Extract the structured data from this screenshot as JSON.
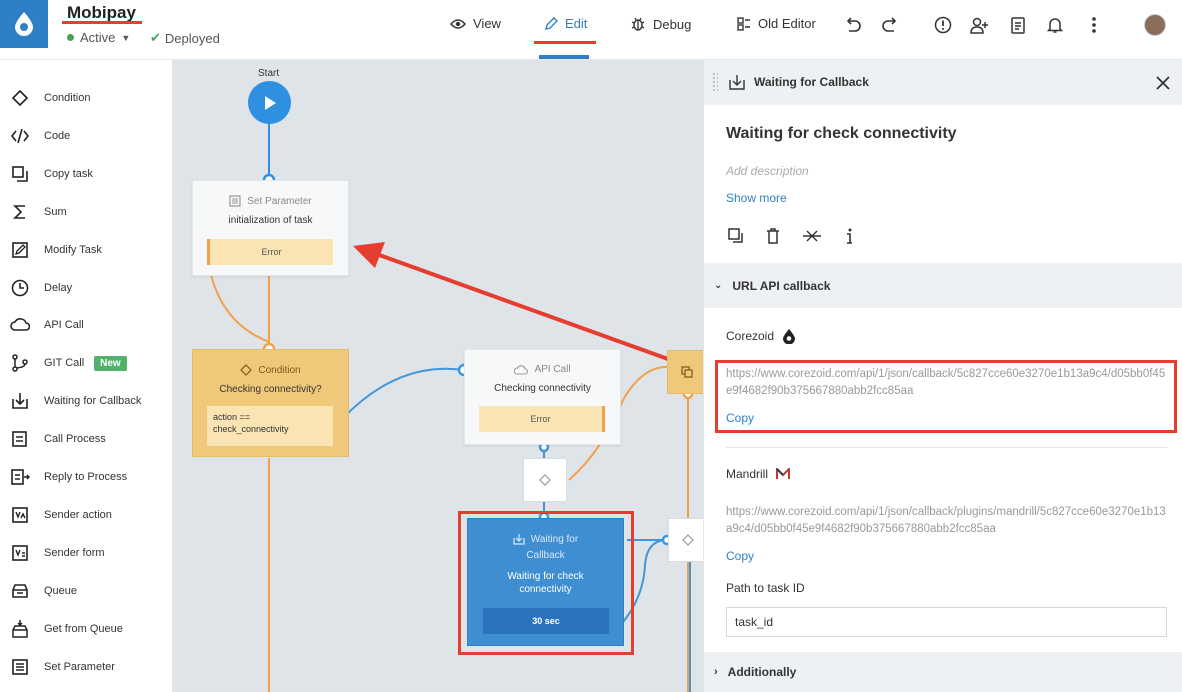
{
  "header": {
    "app_title": "Mobipay",
    "status": "Active",
    "deployed": "Deployed",
    "nav": {
      "view": "View",
      "edit": "Edit",
      "debug": "Debug",
      "old_editor": "Old Editor"
    }
  },
  "sidebar": {
    "items": [
      {
        "label": "Condition",
        "icon": "condition-icon"
      },
      {
        "label": "Code",
        "icon": "code-icon"
      },
      {
        "label": "Copy task",
        "icon": "copy-task-icon"
      },
      {
        "label": "Sum",
        "icon": "sum-icon"
      },
      {
        "label": "Modify Task",
        "icon": "modify-task-icon"
      },
      {
        "label": "Delay",
        "icon": "delay-icon"
      },
      {
        "label": "API Call",
        "icon": "api-call-icon"
      },
      {
        "label": "GIT Call",
        "icon": "git-call-icon",
        "badge": "New"
      },
      {
        "label": "Waiting for Callback",
        "icon": "waiting-callback-icon"
      },
      {
        "label": "Call Process",
        "icon": "call-process-icon"
      },
      {
        "label": "Reply to Process",
        "icon": "reply-process-icon"
      },
      {
        "label": "Sender action",
        "icon": "sender-action-icon"
      },
      {
        "label": "Sender form",
        "icon": "sender-form-icon"
      },
      {
        "label": "Queue",
        "icon": "queue-icon"
      },
      {
        "label": "Get from Queue",
        "icon": "get-queue-icon"
      },
      {
        "label": "Set Parameter",
        "icon": "set-parameter-icon"
      }
    ]
  },
  "canvas": {
    "start_label": "Start",
    "set_param": {
      "head": "Set Parameter",
      "title": "initialization of task",
      "error": "Error"
    },
    "condition": {
      "head": "Condition",
      "title": "Checking connectivity?",
      "expr1": "action ==",
      "expr2": "check_connectivity"
    },
    "api_call": {
      "head": "API Call",
      "title": "Checking connectivity",
      "error": "Error"
    },
    "wfc": {
      "head1": "Waiting for",
      "head2": "Callback",
      "title1": "Waiting for check",
      "title2": "connectivity",
      "time": "30 sec"
    }
  },
  "panel": {
    "head_title": "Waiting for Callback",
    "title": "Waiting for check connectivity",
    "description_placeholder": "Add description",
    "show_more": "Show more",
    "section_url": "URL API callback",
    "corezoid_label": "Corezoid",
    "corezoid_url": "https://www.corezoid.com/api/1/json/callback/5c827cce60e3270e1b13a9c4/d05bb0f45e9f4682f90b375667880abb2fcc85aa",
    "copy1": "Copy",
    "mandrill_label": "Mandrill",
    "mandrill_url": "https://www.corezoid.com/api/1/json/callback/plugins/mandrill/5c827cce60e3270e1b13a9c4/d05bb0f45e9f4682f90b375667880abb2fcc85aa",
    "copy2": "Copy",
    "path_label": "Path to task ID",
    "path_value": "task_id",
    "section_additional": "Additionally"
  },
  "colors": {
    "accent": "#2f7fc7",
    "highlight": "#e53d30",
    "condition": "#efc979",
    "error_fill": "#fbe4b4"
  }
}
